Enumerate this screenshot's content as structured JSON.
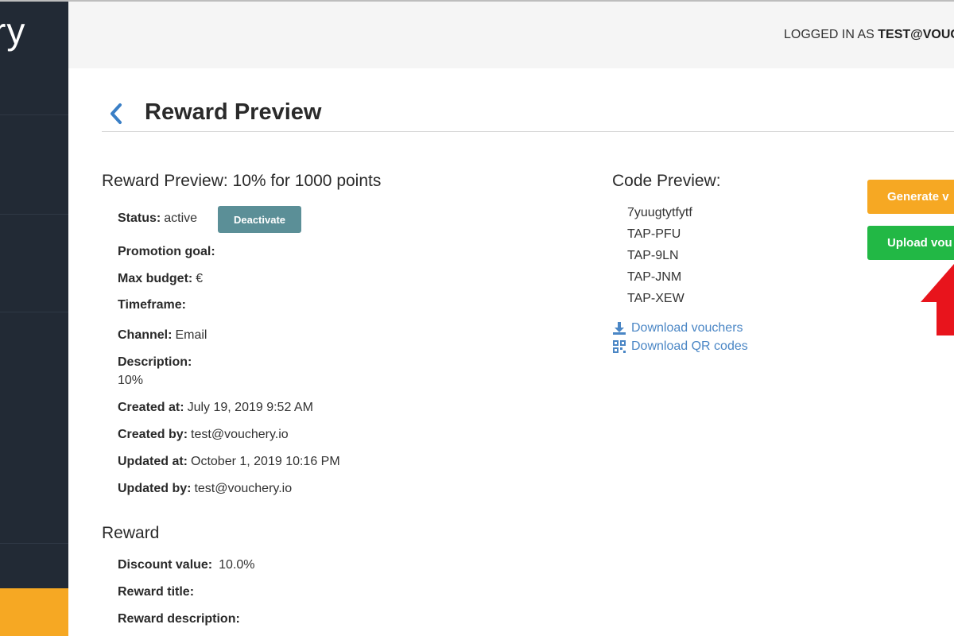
{
  "sidebar": {
    "logo_text": "ry"
  },
  "header": {
    "login_prefix": "LOGGED IN AS ",
    "login_user": "TEST@VOUC"
  },
  "page": {
    "title": "Reward Preview"
  },
  "preview": {
    "heading": "Reward Preview: 10% for 1000 points",
    "status_label": "Status:",
    "status_value": "active",
    "deactivate_label": "Deactivate",
    "promotion_goal_label": "Promotion goal:",
    "max_budget_label": "Max budget:",
    "max_budget_value": "€",
    "timeframe_label": "Timeframe:",
    "channel_label": "Channel:",
    "channel_value": "Email",
    "description_label": "Description:",
    "description_value": "10%",
    "created_at_label": "Created at:",
    "created_at_value": "July 19, 2019 9:52 AM",
    "created_by_label": "Created by:",
    "created_by_value": "test@vouchery.io",
    "updated_at_label": "Updated at:",
    "updated_at_value": "October 1, 2019 10:16 PM",
    "updated_by_label": "Updated by:",
    "updated_by_value": "test@vouchery.io"
  },
  "reward": {
    "heading": "Reward",
    "discount_label": "Discount value:",
    "discount_value": "10.0%",
    "title_label": "Reward title:",
    "description_label": "Reward description:"
  },
  "code_preview": {
    "heading": "Code Preview:",
    "codes": [
      "7yuugtytfytf",
      "TAP-PFU",
      "TAP-9LN",
      "TAP-JNM",
      "TAP-XEW"
    ],
    "download_vouchers_label": "Download vouchers",
    "download_qr_label": "Download QR codes"
  },
  "actions": {
    "generate_label": "Generate v",
    "upload_label": "Upload vou"
  },
  "colors": {
    "sidebar_bg": "#222a35",
    "accent_orange": "#f6a823",
    "accent_green": "#22b845",
    "deactivate_bg": "#5b8f97",
    "link_blue": "#4a86c5",
    "arrow_red": "#e8141c"
  }
}
